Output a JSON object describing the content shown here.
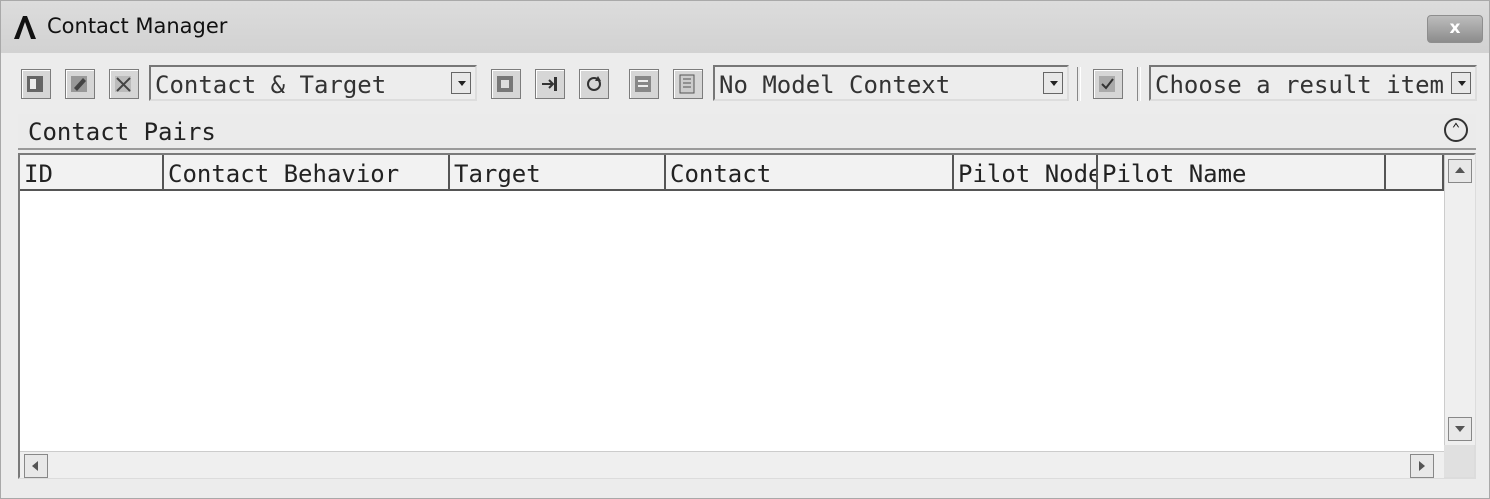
{
  "window": {
    "title": "Contact Manager",
    "close_label": "x"
  },
  "toolbar": {
    "buttons": [
      "define-contact-icon",
      "edit-contact-icon",
      "delete-contact-icon",
      "select-icon",
      "flip-icon",
      "refresh-icon",
      "list-icon",
      "properties-icon",
      "check-icon"
    ],
    "contact_filter": {
      "value": "Contact & Target"
    },
    "model_context": {
      "value": "No Model Context"
    },
    "result_item": {
      "value": "Choose a result item"
    }
  },
  "section": {
    "title": "Contact Pairs",
    "collapse_icon": "double-chevron-up-icon"
  },
  "table": {
    "columns": [
      "ID",
      "Contact Behavior",
      "Target",
      "Contact",
      "Pilot Node",
      "Pilot Name",
      ""
    ],
    "rows": []
  }
}
